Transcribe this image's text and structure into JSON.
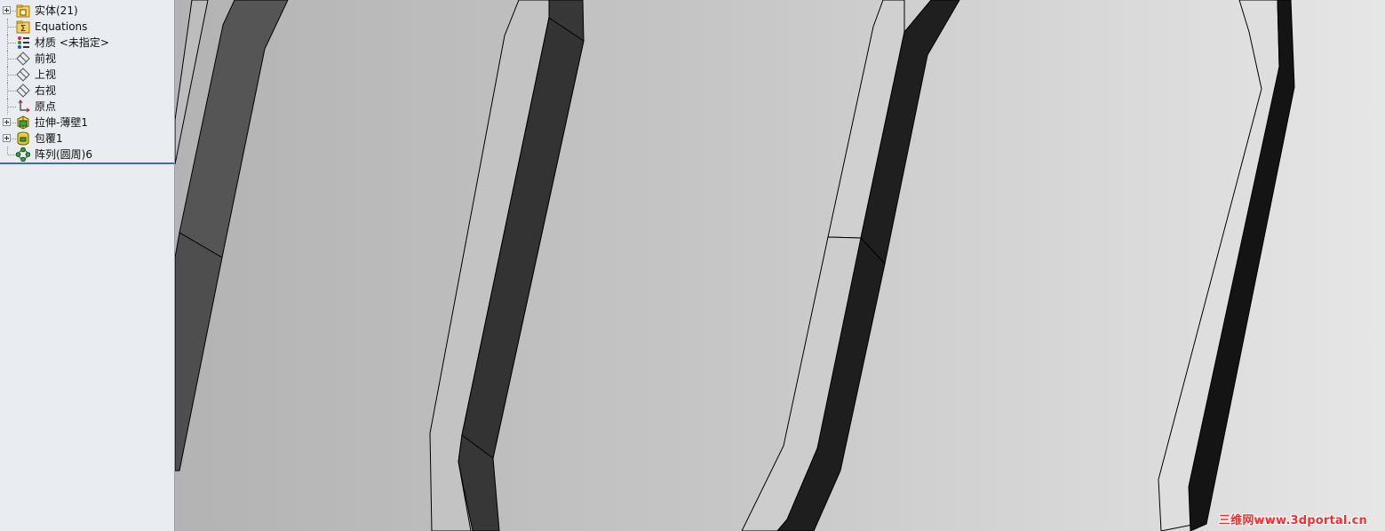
{
  "feature_tree": {
    "items": [
      {
        "label": "实体(21)",
        "icon": "solid-bodies-folder-icon",
        "expandable": true
      },
      {
        "label": "Equations",
        "icon": "equations-folder-icon",
        "expandable": false
      },
      {
        "label": "材质 <未指定>",
        "icon": "material-icon",
        "expandable": false
      },
      {
        "label": "前视",
        "icon": "plane-icon",
        "expandable": false
      },
      {
        "label": "上视",
        "icon": "plane-icon",
        "expandable": false
      },
      {
        "label": "右视",
        "icon": "plane-icon",
        "expandable": false
      },
      {
        "label": "原点",
        "icon": "origin-icon",
        "expandable": false
      },
      {
        "label": "拉伸-薄壁1",
        "icon": "extrude-thin-icon",
        "expandable": true
      },
      {
        "label": "包覆1",
        "icon": "wrap-icon",
        "expandable": true
      },
      {
        "label": "阵列(圆周)6",
        "icon": "circular-pattern-icon",
        "expandable": false
      }
    ]
  },
  "watermark": {
    "text": "三维网www.3dportal.cn"
  },
  "colors": {
    "accent": "#3d6fa8",
    "watermark": "#ff2a2a"
  }
}
